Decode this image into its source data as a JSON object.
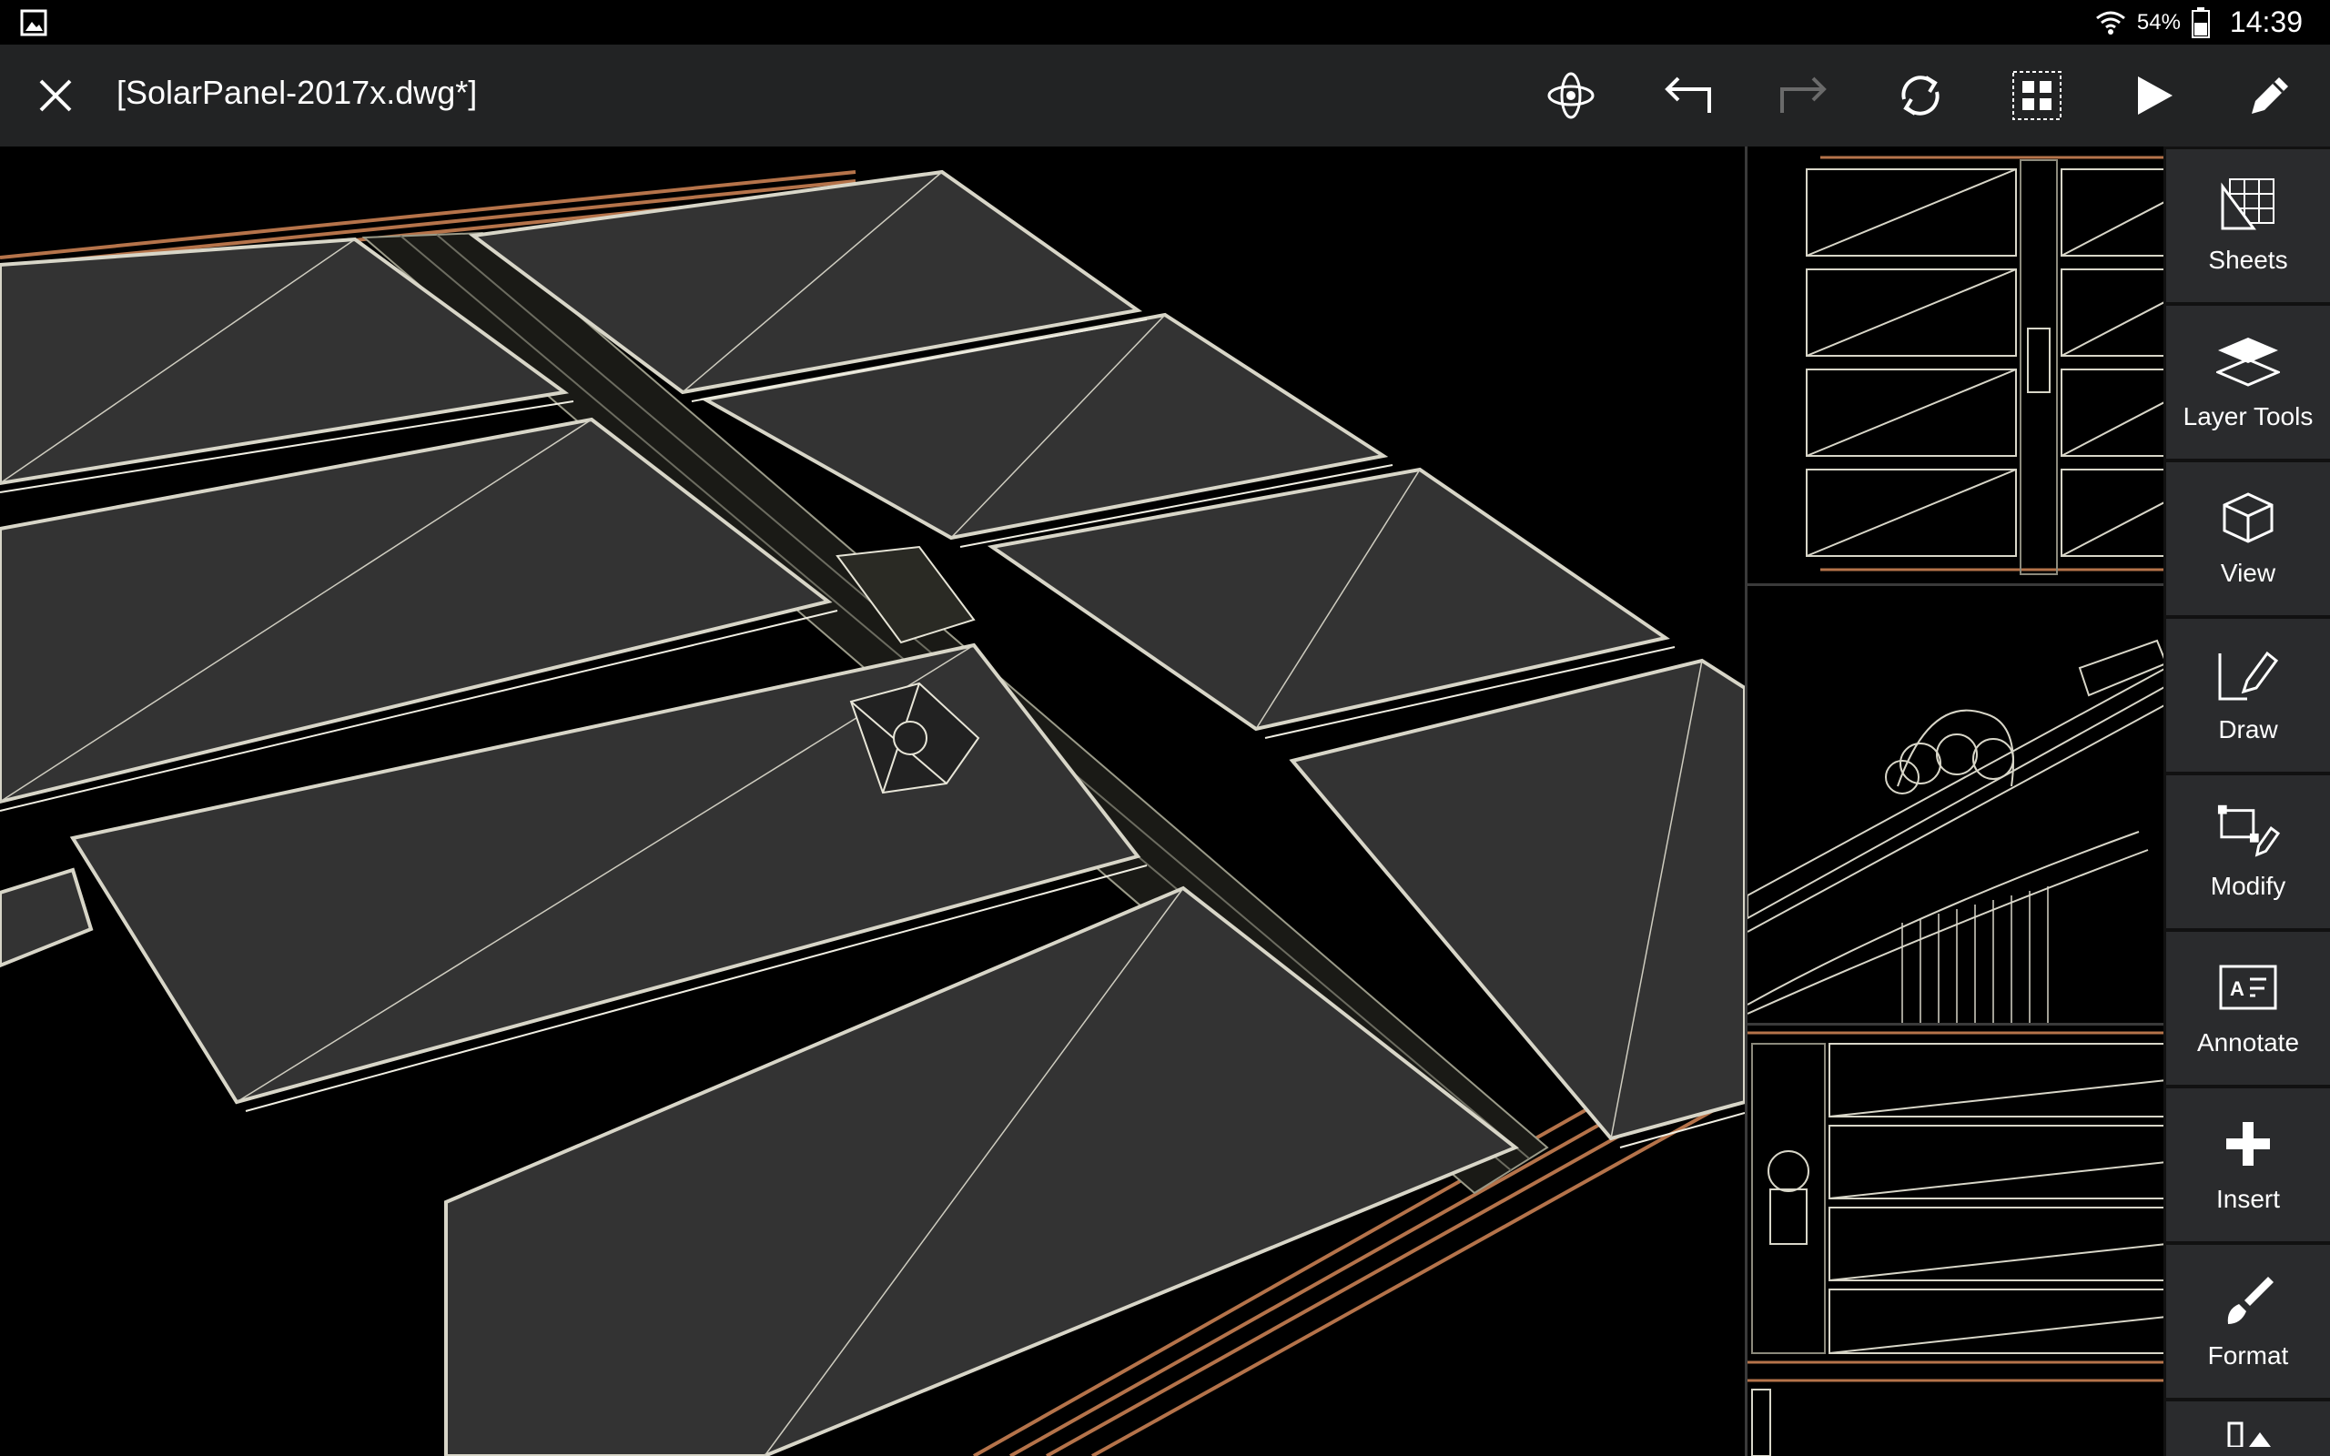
{
  "status_bar": {
    "battery_percent": "54%",
    "time": "14:39",
    "icons": [
      "gallery-icon",
      "wifi-icon",
      "battery-icon"
    ]
  },
  "toolbar": {
    "title": "[SolarPanel-2017x.dwg*]",
    "buttons": [
      {
        "name": "orbit-button",
        "icon": "orbit-icon"
      },
      {
        "name": "undo-button",
        "icon": "undo-arrow-icon"
      },
      {
        "name": "redo-button",
        "icon": "redo-arrow-icon"
      },
      {
        "name": "regenerate-button",
        "icon": "refresh-icon"
      },
      {
        "name": "layout-button",
        "icon": "grid-icon"
      },
      {
        "name": "play-button",
        "icon": "play-icon"
      },
      {
        "name": "edit-button",
        "icon": "pencil-icon"
      }
    ]
  },
  "right_panel": {
    "items": [
      {
        "label": "Sheets",
        "icon": "sheets-icon"
      },
      {
        "label": "Layer Tools",
        "icon": "layers-icon"
      },
      {
        "label": "View",
        "icon": "cube-icon"
      },
      {
        "label": "Draw",
        "icon": "draw-icon"
      },
      {
        "label": "Modify",
        "icon": "modify-icon"
      },
      {
        "label": "Annotate",
        "icon": "annotate-icon"
      },
      {
        "label": "Insert",
        "icon": "plus-icon"
      },
      {
        "label": "Format",
        "icon": "brush-icon"
      }
    ]
  },
  "colors": {
    "toolbar_bg": "#222324",
    "panel_button_bg": "#2a2b2d",
    "panel_fill": "#333333",
    "panel_edge": "#d8d6c8",
    "rail": "#b5734a",
    "disabled_icon": "#6a6a6a"
  }
}
